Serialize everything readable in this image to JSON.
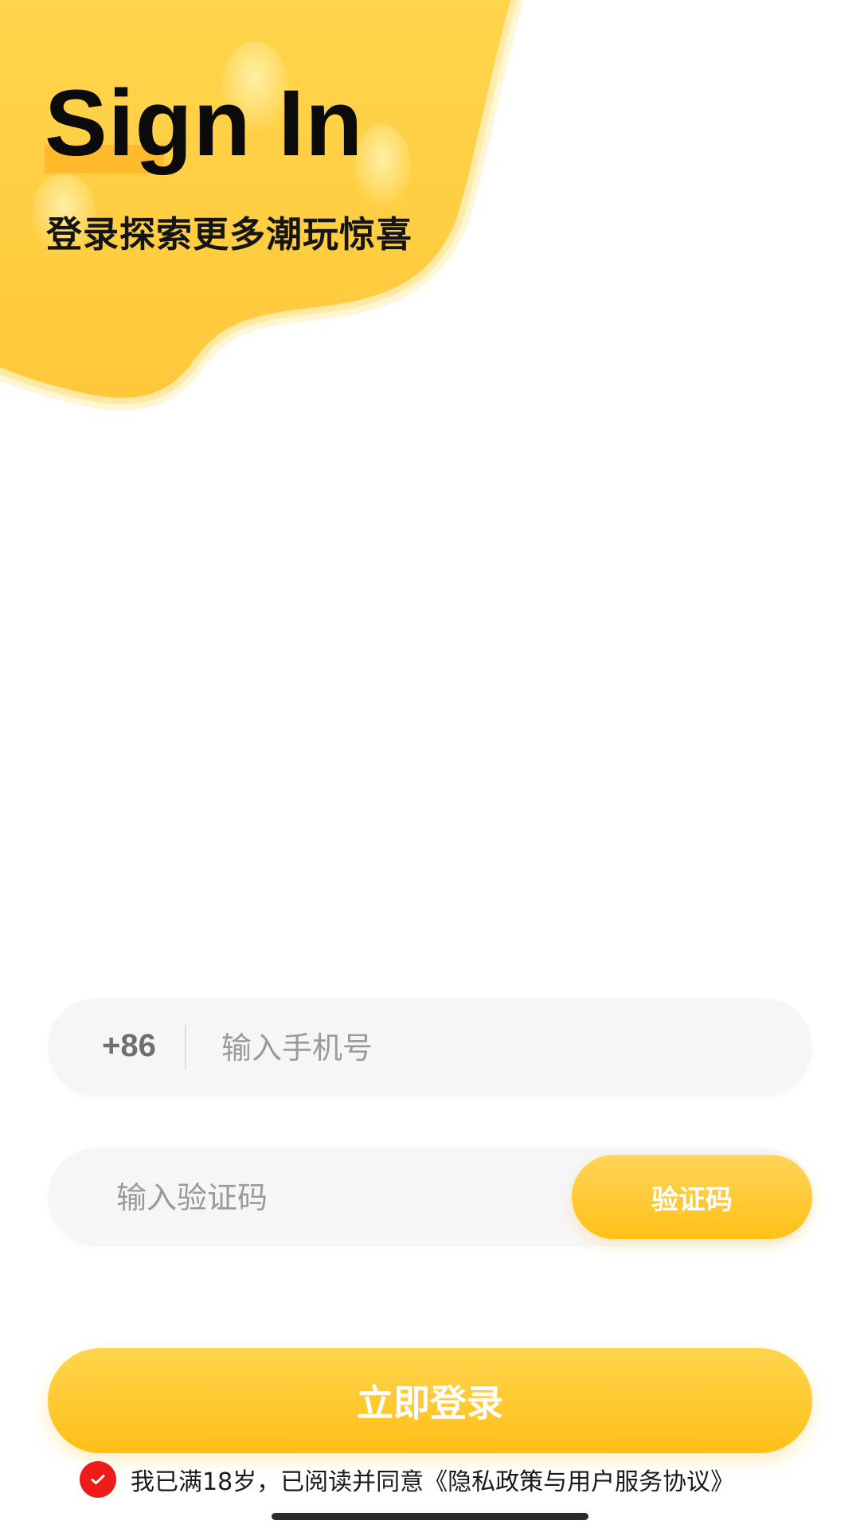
{
  "hero": {
    "title": "Sign In",
    "subtitle": "登录探索更多潮玩惊喜"
  },
  "login_form": {
    "country_code": "+86",
    "phone_placeholder": "输入手机号",
    "code_placeholder": "输入验证码",
    "get_code_button": "验证码",
    "submit_button": "立即登录"
  },
  "agreement": {
    "checked": true,
    "text": "我已满18岁，已阅读并同意《隐私政策与用户服务协议》"
  },
  "colors": {
    "brand_yellow": "#FFC119",
    "brand_yellow_light": "#FFD54D",
    "field_background": "#F6F6F9",
    "checkbox_red": "#EF1B18"
  },
  "icons": {
    "checkbox_mark": "checkmark-icon"
  }
}
